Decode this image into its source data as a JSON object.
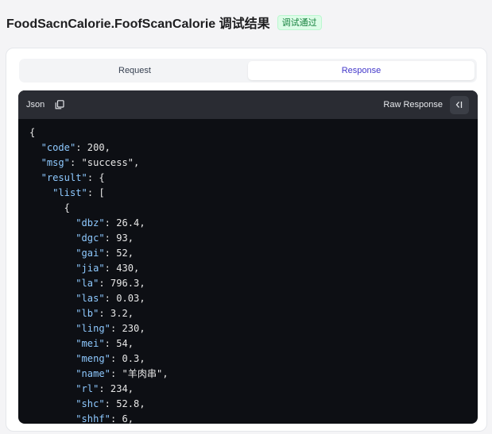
{
  "header": {
    "title": "FoodSacnCalorie.FoofScanCalorie 调试结果",
    "status_badge": "调试通过"
  },
  "tabs": [
    {
      "label": "Request",
      "active": false
    },
    {
      "label": "Response",
      "active": true
    }
  ],
  "response_panel": {
    "format_label": "Json",
    "copy_icon": "copy-icon",
    "raw_label": "Raw Response",
    "raw_icon": "collapse-icon"
  },
  "code_lines": [
    "{",
    "  \"code\": 200,",
    "  \"msg\": \"success\",",
    "  \"result\": {",
    "    \"list\": [",
    "      {",
    "        \"dbz\": 26.4,",
    "        \"dgc\": 93,",
    "        \"gai\": 52,",
    "        \"jia\": 430,",
    "        \"la\": 796.3,",
    "        \"las\": 0.03,",
    "        \"lb\": 3.2,",
    "        \"ling\": 230,",
    "        \"mei\": 54,",
    "        \"meng\": 0.3,",
    "        \"name\": \"羊肉串\",",
    "        \"rl\": 234,",
    "        \"shc\": 52.8,",
    "        \"shhf\": 6,"
  ],
  "colors": {
    "accent": "#4338ca",
    "badge_bg": "#dcfce7",
    "badge_text": "#15803d",
    "code_bg": "#0d0f14",
    "code_key": "#8ec9ff"
  }
}
